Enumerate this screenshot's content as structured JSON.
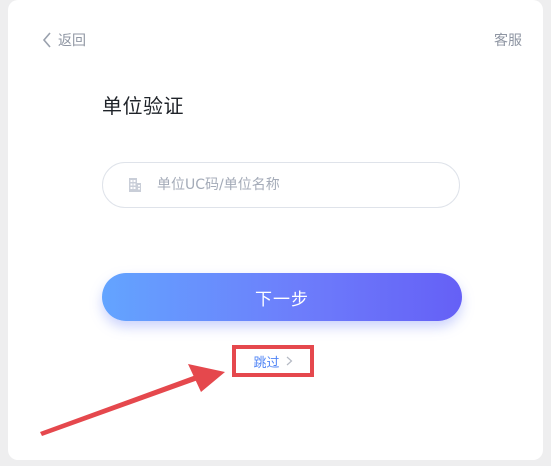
{
  "header": {
    "back_label": "返回",
    "service_label": "客服"
  },
  "main": {
    "title": "单位验证",
    "unit_input": {
      "placeholder": "单位UC码/单位名称",
      "value": ""
    },
    "next_button_label": "下一步",
    "skip_label": "跳过"
  },
  "icons": {
    "back": "chevron-left-icon",
    "building": "building-icon",
    "skip": "chevron-right-icon"
  },
  "colors": {
    "accent_gradient_start": "#63a4ff",
    "accent_gradient_end": "#6560f6",
    "link": "#4f84f6",
    "annotation_red": "#e5484d"
  }
}
